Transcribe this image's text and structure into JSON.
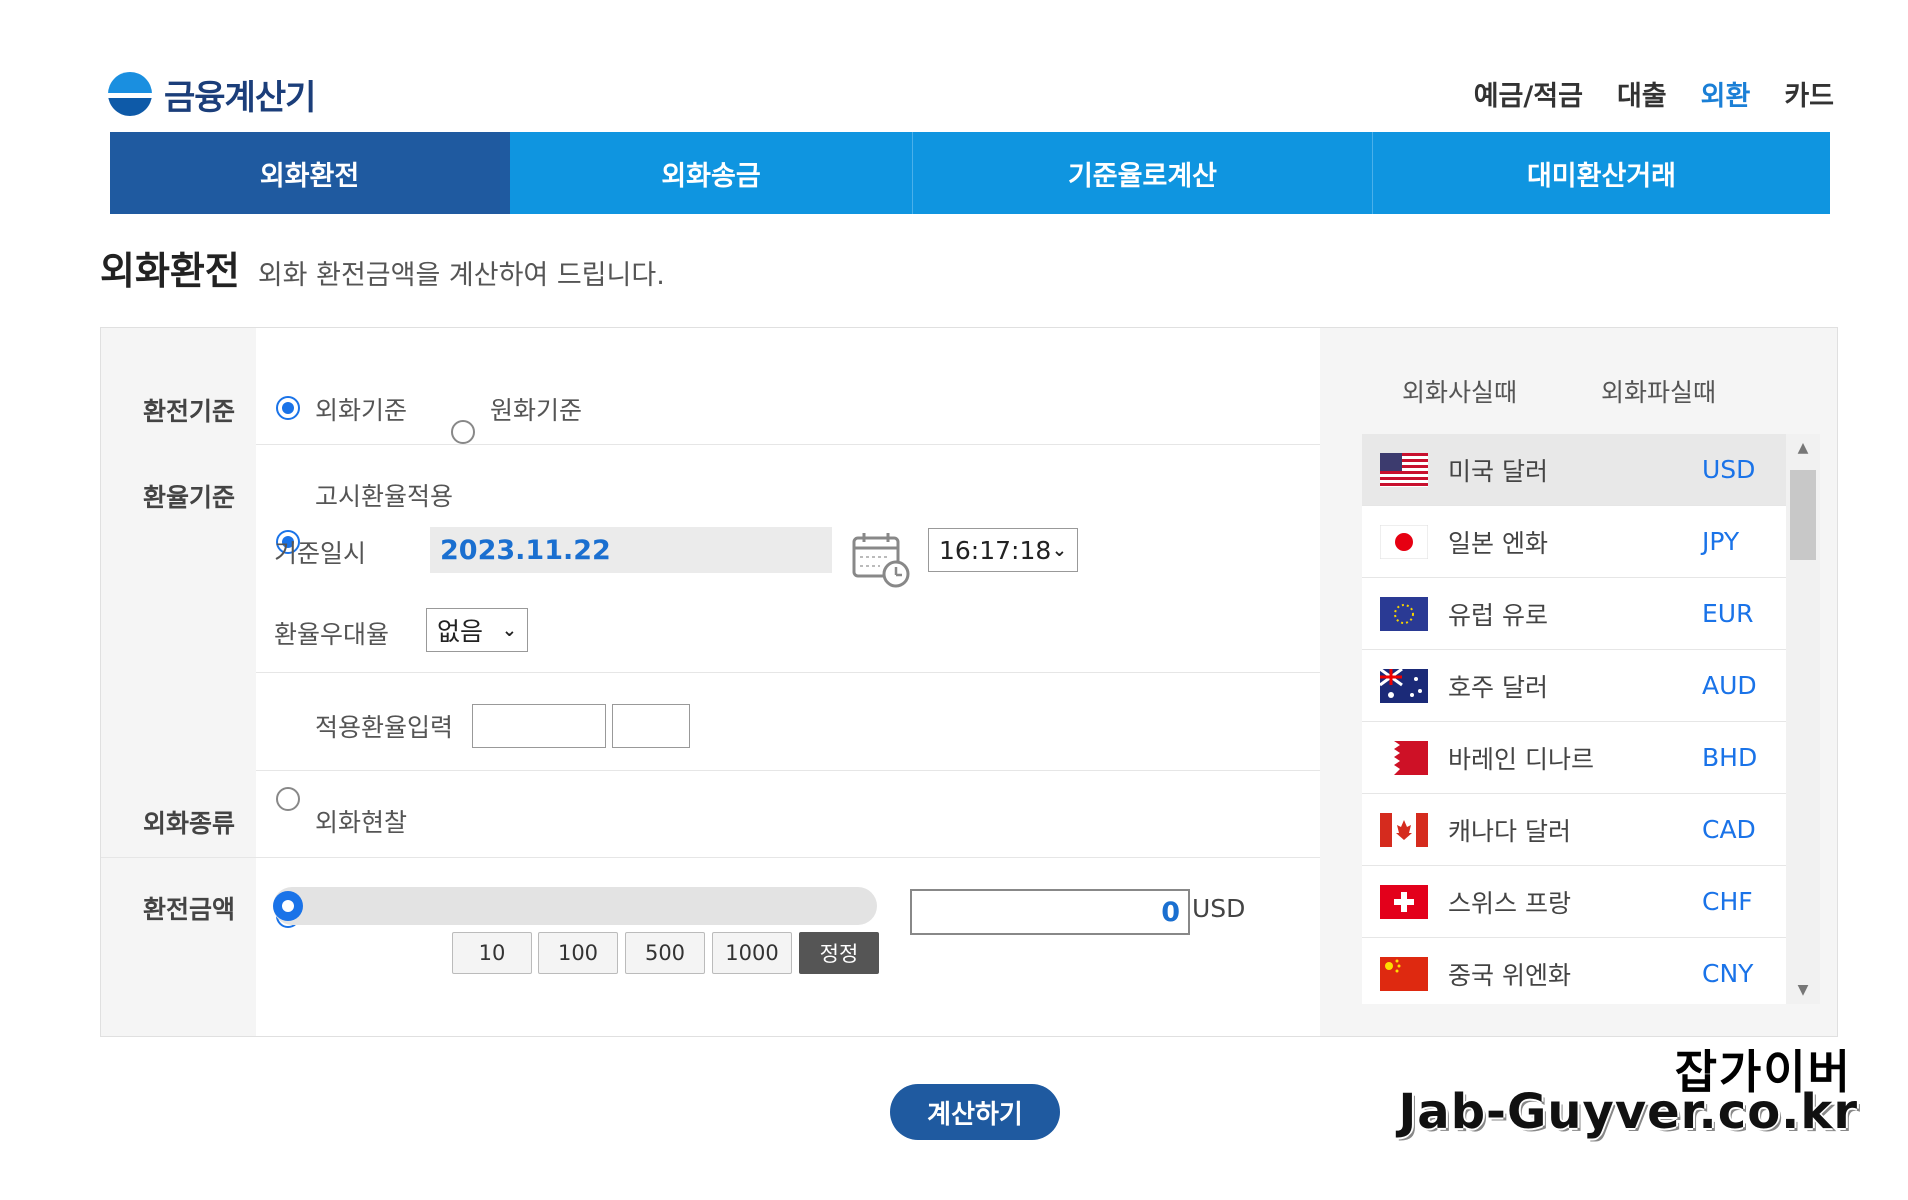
{
  "app": {
    "logo_text": "금융계산기"
  },
  "top_nav": [
    {
      "label": "예금/적금",
      "active": false
    },
    {
      "label": "대출",
      "active": false
    },
    {
      "label": "외환",
      "active": true
    },
    {
      "label": "카드",
      "active": false
    }
  ],
  "tabs": [
    {
      "label": "외화환전",
      "active": true
    },
    {
      "label": "외화송금",
      "active": false
    },
    {
      "label": "기준율로계산",
      "active": false
    },
    {
      "label": "대미환산거래",
      "active": false
    }
  ],
  "page": {
    "title": "외화환전",
    "subtitle": "외화 환전금액을 계산하여 드립니다."
  },
  "form": {
    "exchange_basis": {
      "label": "환전기준",
      "options": [
        "외화기준",
        "원화기준"
      ],
      "selected": "외화기준"
    },
    "rate_basis": {
      "label": "환율기준",
      "notice_option": "고시환율적용",
      "datetime_label": "기준일시",
      "date_value": "2023.11.22",
      "time_value": "16:17:18",
      "preferential_label": "환율우대율",
      "preferential_value": "없음",
      "manual_option": "적용환율입력"
    },
    "currency_type": {
      "label": "외화종류",
      "option": "외화현찰"
    },
    "amount": {
      "label": "환전금액",
      "value": "0",
      "unit": "USD",
      "quick_buttons": [
        "10",
        "100",
        "500",
        "1000"
      ],
      "correct_button": "정정"
    }
  },
  "side": {
    "modes": [
      "외화사실때",
      "외화파실때"
    ],
    "selected_mode": "외화사실때",
    "currencies": [
      {
        "name": "미국 달러",
        "code": "USD",
        "flag": "us-flag-icon",
        "selected": true
      },
      {
        "name": "일본 엔화",
        "code": "JPY",
        "flag": "japan-flag-icon",
        "selected": false
      },
      {
        "name": "유럽 유로",
        "code": "EUR",
        "flag": "eu-flag-icon",
        "selected": false
      },
      {
        "name": "호주 달러",
        "code": "AUD",
        "flag": "australia-flag-icon",
        "selected": false
      },
      {
        "name": "바레인 디나르",
        "code": "BHD",
        "flag": "bahrain-flag-icon",
        "selected": false
      },
      {
        "name": "캐나다 달러",
        "code": "CAD",
        "flag": "canada-flag-icon",
        "selected": false
      },
      {
        "name": "스위스 프랑",
        "code": "CHF",
        "flag": "swiss-flag-icon",
        "selected": false
      },
      {
        "name": "중국 위엔화",
        "code": "CNY",
        "flag": "china-flag-icon",
        "selected": false
      }
    ]
  },
  "actions": {
    "calculate_label": "계산하기"
  },
  "watermark": {
    "line1": "잡가이버",
    "line2": "Jab-Guyver.co.kr"
  },
  "colors": {
    "primary_blue": "#0f95e0",
    "active_tab": "#1f5aa0",
    "link_blue": "#1a73e8"
  }
}
